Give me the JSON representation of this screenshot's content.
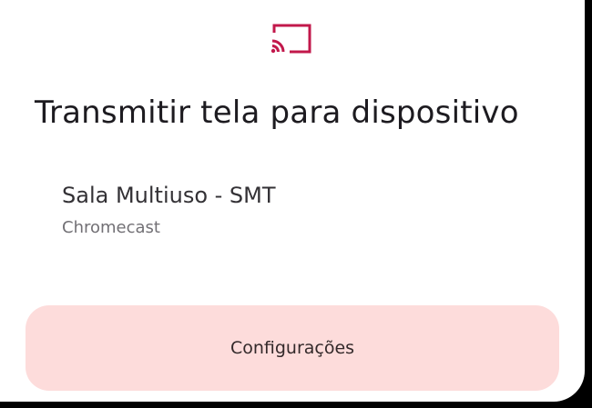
{
  "dialog": {
    "icon": "cast-icon",
    "title": "Transmitir tela para dispositivo",
    "accent_color": "#c2184b",
    "devices": [
      {
        "name": "Sala Multiuso - SMT",
        "type": "Chromecast"
      }
    ],
    "settings_button_label": "Configurações",
    "settings_button_color": "#fddcdb"
  }
}
